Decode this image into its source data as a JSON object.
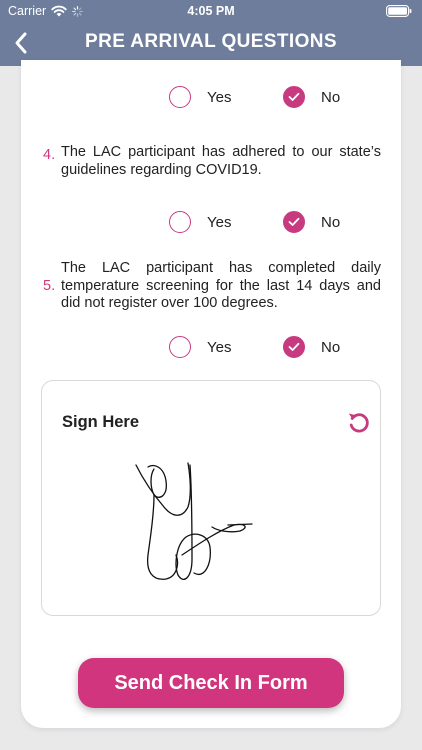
{
  "status_bar": {
    "carrier": "Carrier",
    "time": "4:05 PM"
  },
  "header": {
    "title": "PRE ARRIVAL QUESTIONS",
    "color": "#6d7d9b"
  },
  "accent_color": "#d0357e",
  "questions": [
    {
      "number": "",
      "text": "",
      "yes_label": "Yes",
      "no_label": "No",
      "selected": "no"
    },
    {
      "number": "4.",
      "text": "The LAC participant has adhered to our state’s guidelines regarding COVID19.",
      "yes_label": "Yes",
      "no_label": "No",
      "selected": "no"
    },
    {
      "number": "5.",
      "text": "The LAC participant has completed daily temperature screening for the last 14 days and did not register over 100 degrees.",
      "yes_label": "Yes",
      "no_label": "No",
      "selected": "no"
    }
  ],
  "signature": {
    "label": "Sign Here",
    "reset_icon": "reset-icon"
  },
  "submit": {
    "label": "Send Check In Form"
  }
}
